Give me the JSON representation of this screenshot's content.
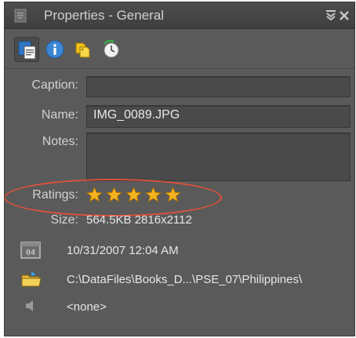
{
  "window": {
    "title": "Properties - General"
  },
  "toolbar": {
    "tabs": [
      {
        "icon": "general-properties-icon",
        "active": true
      },
      {
        "icon": "info-icon",
        "active": false
      },
      {
        "icon": "keyword-tags-icon",
        "active": false
      },
      {
        "icon": "history-icon",
        "active": false
      }
    ]
  },
  "fields": {
    "caption_label": "Caption:",
    "caption_value": "",
    "name_label": "Name:",
    "name_value": "IMG_0089.JPG",
    "notes_label": "Notes:",
    "notes_value": "",
    "ratings_label": "Ratings:",
    "rating": 5,
    "rating_max": 5,
    "size_label": "Size:",
    "size_value": "564.5KB  2816x2112"
  },
  "info": {
    "date": "10/31/2007 12:04 AM",
    "path": "C:\\DataFiles\\Books_D...\\PSE_07\\Philippines\\",
    "audio": "<none>"
  },
  "colors": {
    "panel_bg": "#5a5a5a",
    "star": "#f4b31f",
    "highlight_ellipse": "#e0513a"
  }
}
